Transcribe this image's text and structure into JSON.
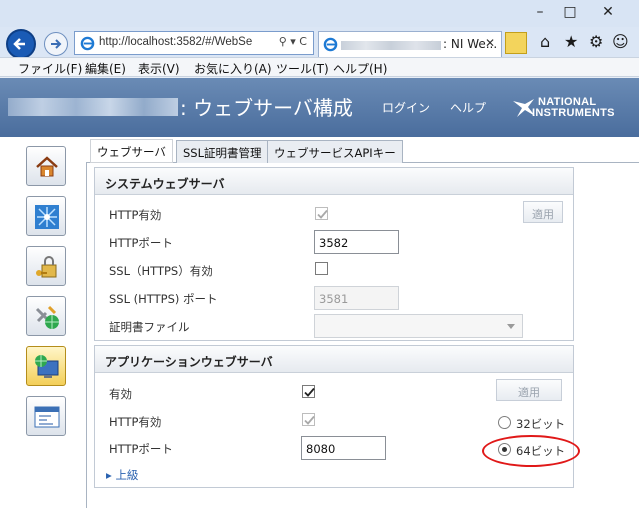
{
  "browser": {
    "url": "http://localhost:3582/#/WebSe",
    "tab_title": ": NI We...",
    "menu": [
      "ファイル(F)",
      "編集(E)",
      "表示(V)",
      "お気に入り(A)",
      "ツール(T)",
      "ヘルプ(H)"
    ],
    "window_controls": [
      "minimize-icon",
      "maximize-icon",
      "close-icon"
    ]
  },
  "header": {
    "title": ": ウェブサーバ構成",
    "login": "ログイン",
    "help": "ヘルプ",
    "logo_line1": "NATIONAL",
    "logo_line2": "INSTRUMENTS"
  },
  "tabs": [
    "ウェブサーバ",
    "SSL証明書管理",
    "ウェブサービスAPIキー"
  ],
  "system_server": {
    "title": "システムウェブサーバ",
    "apply": "適用",
    "http_enabled_label": "HTTP有効",
    "http_enabled": true,
    "http_port_label": "HTTPポート",
    "http_port": "3582",
    "ssl_enabled_label": "SSL（HTTPS）有効",
    "ssl_enabled": false,
    "ssl_port_label": "SSL (HTTPS) ポート",
    "ssl_port": "3581",
    "cert_label": "証明書ファイル",
    "cert_value": ""
  },
  "app_server": {
    "title": "アプリケーションウェブサーバ",
    "apply": "適用",
    "enabled_label": "有効",
    "enabled": true,
    "http_enabled_label": "HTTP有効",
    "http_enabled": true,
    "http_port_label": "HTTPポート",
    "http_port": "8080",
    "bit32": "32ビット",
    "bit64": "64ビット",
    "selected_bits": "64ビット",
    "advanced": "上級"
  },
  "colors": {
    "header": "#5a7daa",
    "highlight": "#e01818",
    "link": "#2a62b0"
  }
}
